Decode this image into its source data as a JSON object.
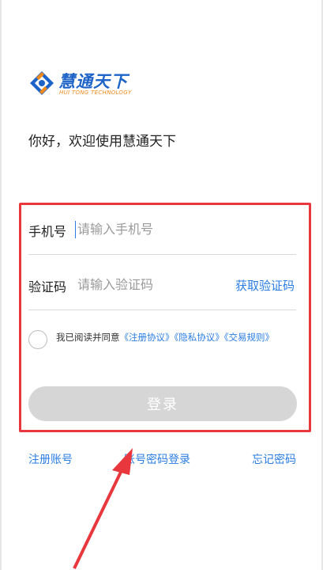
{
  "brand": {
    "name": "慧通天下",
    "subtitle": "HUI TONG TECHNOLOGY",
    "logo_icon": "huitong-logo-icon",
    "primary_color": "#1e63c8",
    "accent_color": "#f08a1c"
  },
  "greeting": "你好，欢迎使用慧通天下",
  "form": {
    "highlight_color": "#e8383d",
    "phone": {
      "label": "手机号",
      "placeholder": "请输入手机号",
      "value": ""
    },
    "code": {
      "label": "验证码",
      "placeholder": "请输入验证码",
      "value": "",
      "get_code_label": "获取验证码"
    },
    "agreement": {
      "checked": false,
      "prefix": "我已阅读并同意",
      "links": [
        "《注册协议》",
        "《隐私协议》",
        "《交易规则》"
      ]
    },
    "login_label": "登录"
  },
  "bottom_links": {
    "register": "注册账号",
    "password_login": "账号密码登录",
    "forgot_password": "忘记密码"
  },
  "link_color": "#2a7de1"
}
